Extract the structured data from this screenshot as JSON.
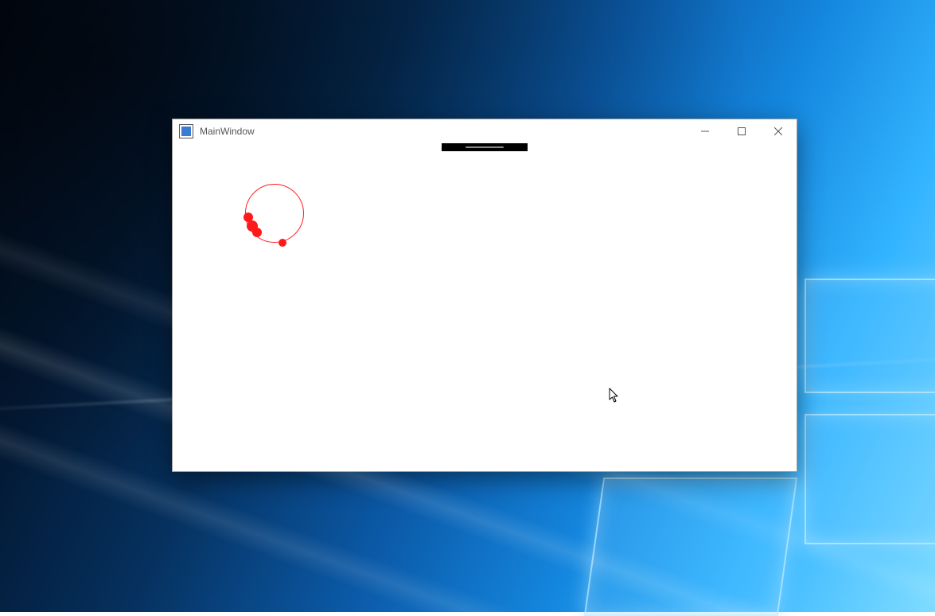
{
  "window": {
    "title": "MainWindow",
    "controls": {
      "minimize_tooltip": "Minimize",
      "maximize_tooltip": "Maximize",
      "close_tooltip": "Close"
    }
  },
  "spinner": {
    "color": "#ff1a1a",
    "dot_count": 4
  }
}
